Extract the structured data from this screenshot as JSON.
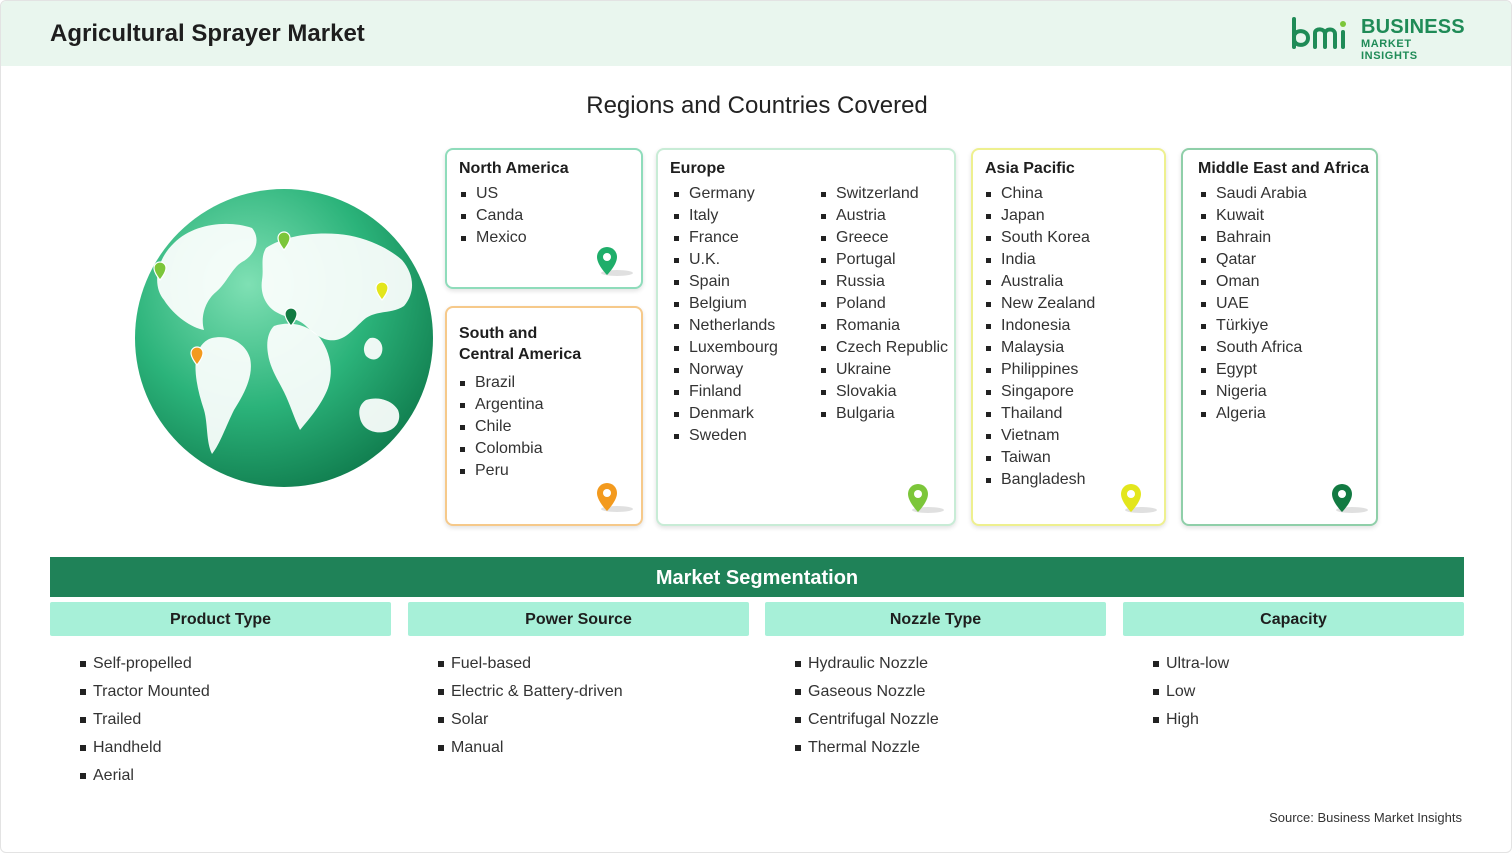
{
  "header": {
    "title": "Agricultural Sprayer Market",
    "logo_line1": "BUSINESS",
    "logo_line2": "MARKET INSIGHTS"
  },
  "regions": {
    "title": "Regions and Countries Covered",
    "north_america": {
      "name": "North America",
      "countries": [
        "US",
        "Canda",
        "Mexico"
      ],
      "pin_color": "#1fae6a"
    },
    "south_central_america": {
      "name_line1": "South and",
      "name_line2": "Central America",
      "countries": [
        "Brazil",
        "Argentina",
        "Chile",
        "Colombia",
        "Peru"
      ],
      "pin_color": "#f39a1e"
    },
    "europe": {
      "name": "Europe",
      "countries_col1": [
        "Germany",
        "Italy",
        "France",
        "U.K.",
        "Spain",
        "Belgium",
        "Netherlands",
        "Luxembourg",
        "Norway",
        "Finland",
        "Denmark",
        "Sweden"
      ],
      "countries_col2": [
        "Switzerland",
        "Austria",
        "Greece",
        "Portugal",
        "Russia",
        "Poland",
        "Romania",
        "Czech Republic",
        "Ukraine",
        "Slovakia",
        "Bulgaria"
      ],
      "pin_color": "#7cc63a"
    },
    "asia_pacific": {
      "name": "Asia Pacific",
      "countries": [
        "China",
        "Japan",
        "South Korea",
        "India",
        "Australia",
        "New Zealand",
        "Indonesia",
        "Malaysia",
        "Philippines",
        "Singapore",
        "Thailand",
        "Vietnam",
        "Taiwan",
        "Bangladesh"
      ],
      "pin_color": "#e3e61c"
    },
    "mea": {
      "name": "Middle East and Africa",
      "countries": [
        "Saudi Arabia",
        "Kuwait",
        "Bahrain",
        "Qatar",
        "Oman",
        "UAE",
        "Türkiye",
        "South Africa",
        "Egypt",
        "Nigeria",
        "Algeria"
      ],
      "pin_color": "#127a42"
    }
  },
  "segmentation": {
    "title": "Market Segmentation",
    "columns": [
      {
        "heading": "Product Type",
        "items": [
          "Self-propelled",
          "Tractor Mounted",
          "Trailed",
          "Handheld",
          "Aerial"
        ]
      },
      {
        "heading": "Power Source",
        "items": [
          "Fuel-based",
          "Electric & Battery-driven",
          "Solar",
          "Manual"
        ]
      },
      {
        "heading": "Nozzle Type",
        "items": [
          "Hydraulic Nozzle",
          "Gaseous Nozzle",
          "Centrifugal Nozzle",
          "Thermal Nozzle"
        ]
      },
      {
        "heading": "Capacity",
        "items": [
          "Ultra-low",
          "Low",
          "High"
        ]
      }
    ]
  },
  "source": "Source: Business Market Insights",
  "colors": {
    "header_bg": "#e9f6ee",
    "brand_green": "#1f8b57",
    "segment_bar": "#1f8258",
    "segment_head": "#a7f0d8"
  }
}
